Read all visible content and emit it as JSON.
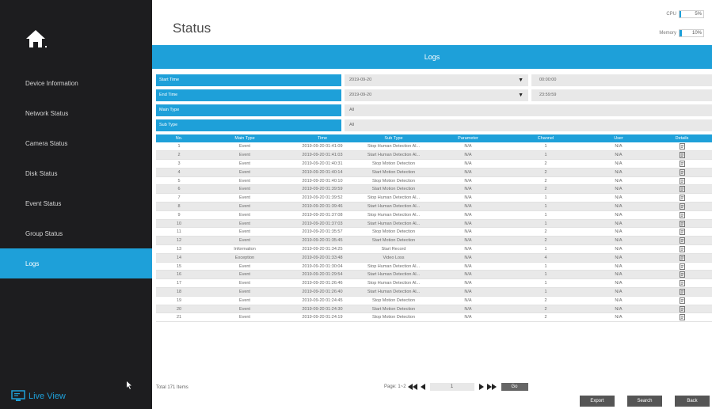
{
  "header": {
    "title": "Status"
  },
  "meters": [
    {
      "label": "CPU",
      "value": "5%",
      "level": 0.05
    },
    {
      "label": "Memory",
      "value": "10%",
      "level": 0.1
    }
  ],
  "sidebar": {
    "items": [
      {
        "label": "Device Information"
      },
      {
        "label": "Network Status"
      },
      {
        "label": "Camera Status"
      },
      {
        "label": "Disk Status"
      },
      {
        "label": "Event Status"
      },
      {
        "label": "Group Status"
      },
      {
        "label": "Logs"
      }
    ],
    "live_view": "Live View"
  },
  "banner": {
    "title": "Logs"
  },
  "filters": {
    "start_label": "Start Time",
    "start_date": "2019-09-20",
    "start_time": "00:00:00",
    "end_label": "End Time",
    "end_date": "2019-09-20",
    "end_time": "23:59:59",
    "main_type_label": "Main Type",
    "main_type_value": "All",
    "sub_type_label": "Sub Type",
    "sub_type_value": "All"
  },
  "table": {
    "headers": [
      "No.",
      "Main Type",
      "Time",
      "Sub Type",
      "Parameter",
      "Channel",
      "User",
      "Details"
    ],
    "rows": [
      [
        "1",
        "Event",
        "2019-09-20 01:41:09",
        "Stop Human Detection Al...",
        "N/A",
        "1",
        "N/A"
      ],
      [
        "2",
        "Event",
        "2019-09-20 01:41:03",
        "Start Human Detection Al...",
        "N/A",
        "1",
        "N/A"
      ],
      [
        "3",
        "Event",
        "2019-09-20 01:40:31",
        "Stop Motion Detection",
        "N/A",
        "2",
        "N/A"
      ],
      [
        "4",
        "Event",
        "2019-09-20 01:40:14",
        "Start Motion Detection",
        "N/A",
        "2",
        "N/A"
      ],
      [
        "5",
        "Event",
        "2019-09-20 01:40:10",
        "Stop Motion Detection",
        "N/A",
        "2",
        "N/A"
      ],
      [
        "6",
        "Event",
        "2019-09-20 01:39:59",
        "Start Motion Detection",
        "N/A",
        "2",
        "N/A"
      ],
      [
        "7",
        "Event",
        "2019-09-20 01:39:52",
        "Stop Human Detection Al...",
        "N/A",
        "1",
        "N/A"
      ],
      [
        "8",
        "Event",
        "2019-09-20 01:39:46",
        "Start Human Detection Al...",
        "N/A",
        "1",
        "N/A"
      ],
      [
        "9",
        "Event",
        "2019-09-20 01:37:08",
        "Stop Human Detection Al...",
        "N/A",
        "1",
        "N/A"
      ],
      [
        "10",
        "Event",
        "2019-09-20 01:37:03",
        "Start Human Detection Al...",
        "N/A",
        "1",
        "N/A"
      ],
      [
        "11",
        "Event",
        "2019-09-20 01:35:57",
        "Stop Motion Detection",
        "N/A",
        "2",
        "N/A"
      ],
      [
        "12",
        "Event",
        "2019-09-20 01:35:45",
        "Start Motion Detection",
        "N/A",
        "2",
        "N/A"
      ],
      [
        "13",
        "Information",
        "2019-09-20 01:34:25",
        "Start Record",
        "N/A",
        "1",
        "N/A"
      ],
      [
        "14",
        "Exception",
        "2019-09-20 01:33:48",
        "Video Loss",
        "N/A",
        "4",
        "N/A"
      ],
      [
        "15",
        "Event",
        "2019-09-20 01:30:04",
        "Stop Human Detection Al...",
        "N/A",
        "1",
        "N/A"
      ],
      [
        "16",
        "Event",
        "2019-09-20 01:29:54",
        "Start Human Detection Al...",
        "N/A",
        "1",
        "N/A"
      ],
      [
        "17",
        "Event",
        "2019-09-20 01:26:46",
        "Stop Human Detection Al...",
        "N/A",
        "1",
        "N/A"
      ],
      [
        "18",
        "Event",
        "2019-09-20 01:26:40",
        "Start Human Detection Al...",
        "N/A",
        "1",
        "N/A"
      ],
      [
        "19",
        "Event",
        "2019-09-20 01:24:45",
        "Stop Motion Detection",
        "N/A",
        "2",
        "N/A"
      ],
      [
        "20",
        "Event",
        "2019-09-20 01:24:30",
        "Start Motion Detection",
        "N/A",
        "2",
        "N/A"
      ],
      [
        "21",
        "Event",
        "2019-09-20 01:24:19",
        "Stop Motion Detection",
        "N/A",
        "2",
        "N/A"
      ]
    ]
  },
  "footer": {
    "total": "Total 171 Items",
    "page_label": "Page: 1~2",
    "page_value": "1",
    "go": "Go",
    "export": "Export",
    "search": "Search",
    "back": "Back"
  },
  "colors": {
    "accent": "#1ea0d9",
    "sidebar_bg": "#1d1d1f"
  },
  "icons": {
    "home": "home-icon",
    "details": "document-icon",
    "live_view": "monitor-icon"
  }
}
